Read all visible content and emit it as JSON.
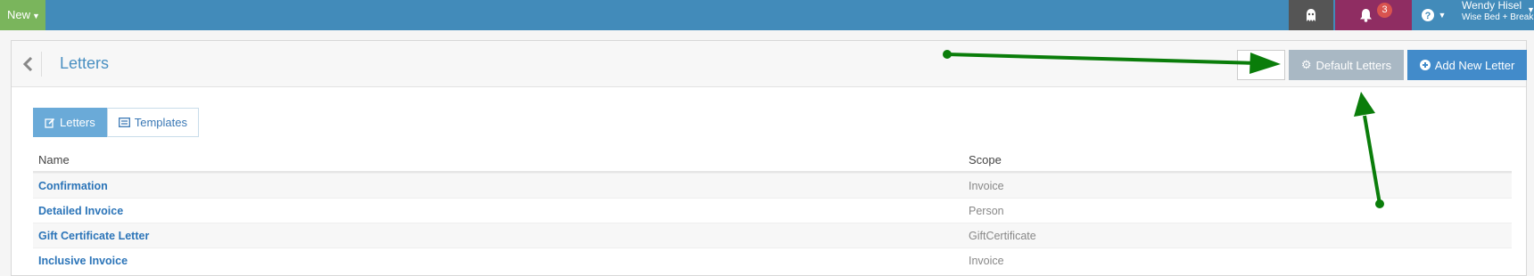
{
  "topbar": {
    "new_label": "New",
    "notification_count": "3",
    "user_name": "Wendy Hisel",
    "user_business": "Wise Bed + Break..."
  },
  "header": {
    "title": "Letters",
    "default_letters_label": "Default Letters",
    "add_new_letter_label": "Add New Letter"
  },
  "tabs": [
    {
      "label": "Letters",
      "active": true
    },
    {
      "label": "Templates",
      "active": false
    }
  ],
  "table": {
    "columns": [
      "Name",
      "Scope"
    ],
    "rows": [
      {
        "name": "Confirmation",
        "scope": "Invoice"
      },
      {
        "name": "Detailed Invoice",
        "scope": "Person"
      },
      {
        "name": "Gift Certificate Letter",
        "scope": "GiftCertificate"
      },
      {
        "name": "Inclusive Invoice",
        "scope": "Invoice"
      }
    ]
  },
  "colors": {
    "topbar": "#428bba",
    "new_button": "#7ab55c",
    "notifications": "#8f2d62",
    "primary_button": "#428bca",
    "annotation_arrow": "#0a7d0a"
  }
}
